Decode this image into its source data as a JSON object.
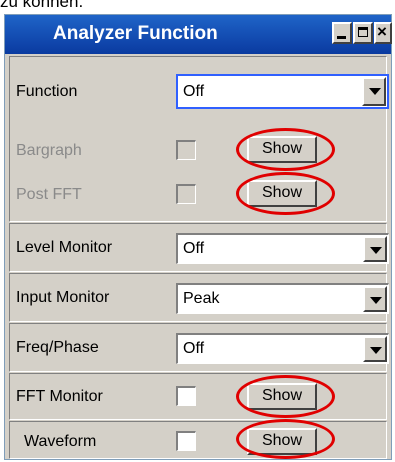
{
  "caption": "zu können.",
  "window": {
    "title": "Analyzer Function"
  },
  "rows": {
    "function": {
      "label": "Function",
      "value": "Off"
    },
    "bargraph": {
      "label": "Bargraph",
      "button": "Show"
    },
    "post_fft": {
      "label": "Post FFT",
      "button": "Show"
    },
    "level_monitor": {
      "label": "Level Monitor",
      "value": "Off"
    },
    "input_monitor": {
      "label": "Input Monitor",
      "value": "Peak"
    },
    "freq_phase": {
      "label": "Freq/Phase",
      "value": "Off"
    },
    "fft_monitor": {
      "label": "FFT Monitor",
      "button": "Show"
    },
    "waveform": {
      "label": "Waveform",
      "button": "Show"
    }
  },
  "colors": {
    "highlight_ring": "#e00000",
    "titlebar": "#0a3aa0"
  }
}
